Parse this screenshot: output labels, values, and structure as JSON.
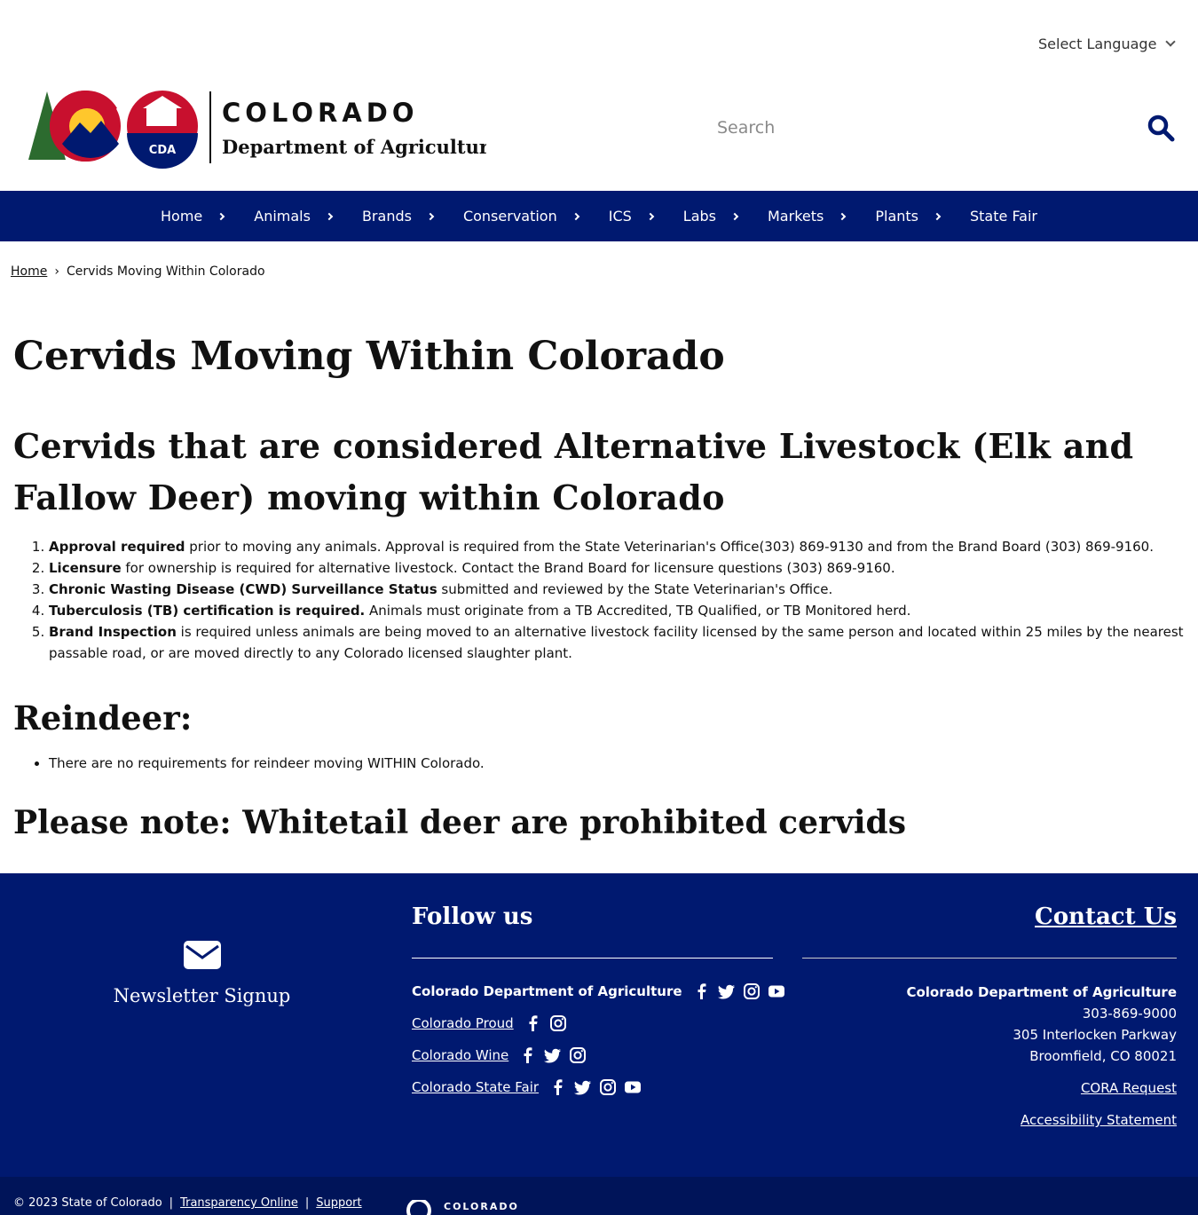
{
  "language": {
    "label": "Select Language"
  },
  "header": {
    "logo_wordmark": "COLORADO",
    "logo_subtitle": "Department of Agriculture",
    "logo_badge": "CDA",
    "search_placeholder": "Search"
  },
  "nav": {
    "items": [
      {
        "label": "Home"
      },
      {
        "label": "Animals"
      },
      {
        "label": "Brands"
      },
      {
        "label": "Conservation"
      },
      {
        "label": "ICS"
      },
      {
        "label": "Labs"
      },
      {
        "label": "Markets"
      },
      {
        "label": "Plants"
      },
      {
        "label": "State Fair"
      }
    ]
  },
  "breadcrumb": {
    "home": "Home",
    "separator": "›",
    "current": "Cervids Moving Within Colorado"
  },
  "main": {
    "title": "Cervids Moving Within Colorado",
    "section_heading": "Cervids that are considered Alternative Livestock (Elk and Fallow Deer) moving within Colorado",
    "requirements": [
      {
        "bold": "Approval required",
        "text": " prior to moving any animals. Approval is required from the State Veterinarian's Office(303) 869-9130 and from the Brand Board (303) 869-9160."
      },
      {
        "bold": "Licensure",
        "text": " for ownership is required for alternative livestock. Contact the Brand Board for licensure questions (303) 869-9160."
      },
      {
        "bold": "Chronic Wasting Disease (CWD) Surveillance Status",
        "text": " submitted and reviewed by the State Veterinarian's Office."
      },
      {
        "bold": "Tuberculosis (TB) certification is required.",
        "text": " Animals must originate from a TB Accredited, TB Qualified, or TB Monitored herd."
      },
      {
        "bold": "Brand Inspection",
        "text": " is required unless animals are being moved to an alternative livestock facility licensed by the same person and located within 25 miles by the nearest passable road, or are moved directly to any Colorado licensed slaughter plant."
      }
    ],
    "reindeer_heading": "Reindeer:",
    "reindeer_items": [
      "There are no requirements for reindeer moving WITHIN Colorado."
    ],
    "note_heading": "Please note: Whitetail deer are prohibited cervids"
  },
  "footer": {
    "newsletter": "Newsletter Signup",
    "follow_title": "Follow us",
    "social": [
      {
        "name": "Colorado Department of Agriculture",
        "icons": [
          "facebook-icon",
          "twitter-icon",
          "instagram-icon",
          "youtube-icon"
        ]
      },
      {
        "name": "Colorado Proud",
        "icons": [
          "facebook-icon",
          "instagram-icon"
        ]
      },
      {
        "name": "Colorado Wine",
        "icons": [
          "facebook-icon",
          "twitter-icon",
          "instagram-icon"
        ]
      },
      {
        "name": "Colorado State Fair",
        "icons": [
          "facebook-icon",
          "twitter-icon",
          "instagram-icon",
          "youtube-icon"
        ]
      }
    ],
    "contact_title": "Contact Us",
    "contact": {
      "org": "Colorado Department of Agriculture",
      "phone": "303-869-9000",
      "address1": "305 Interlocken Parkway",
      "address2": "Broomfield, CO 80021"
    },
    "cora": "CORA Request",
    "accessibility": "Accessibility Statement",
    "copyright": "© 2023 State of Colorado",
    "divider": "|",
    "transparency": "Transparency Online",
    "support": "Support",
    "state_logo_text": "COLORADO"
  },
  "colors": {
    "brand_blue": "#001970",
    "dark_blue": "#001459",
    "red": "#c8102e",
    "gold": "#ffc72c"
  }
}
